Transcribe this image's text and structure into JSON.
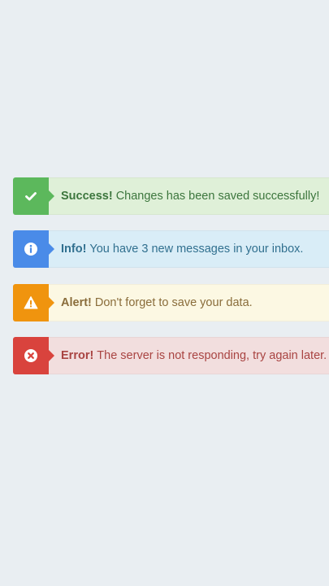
{
  "colors": {
    "page_background": "#e9eef2",
    "success_accent": "#5cb85c",
    "info_accent": "#4a8be8",
    "warning_accent": "#f0940e",
    "danger_accent": "#d9433d"
  },
  "alerts": [
    {
      "type": "success",
      "icon": "check-icon",
      "title": "Success!",
      "message": "Changes has been saved successfully!"
    },
    {
      "type": "info",
      "icon": "info-icon",
      "title": "Info!",
      "message": "You have 3 new messages in your inbox."
    },
    {
      "type": "warning",
      "icon": "warning-triangle-icon",
      "title": "Alert!",
      "message": "Don't forget to save your data."
    },
    {
      "type": "danger",
      "icon": "error-circle-x-icon",
      "title": "Error!",
      "message": "The server is not responding, try again later."
    }
  ]
}
